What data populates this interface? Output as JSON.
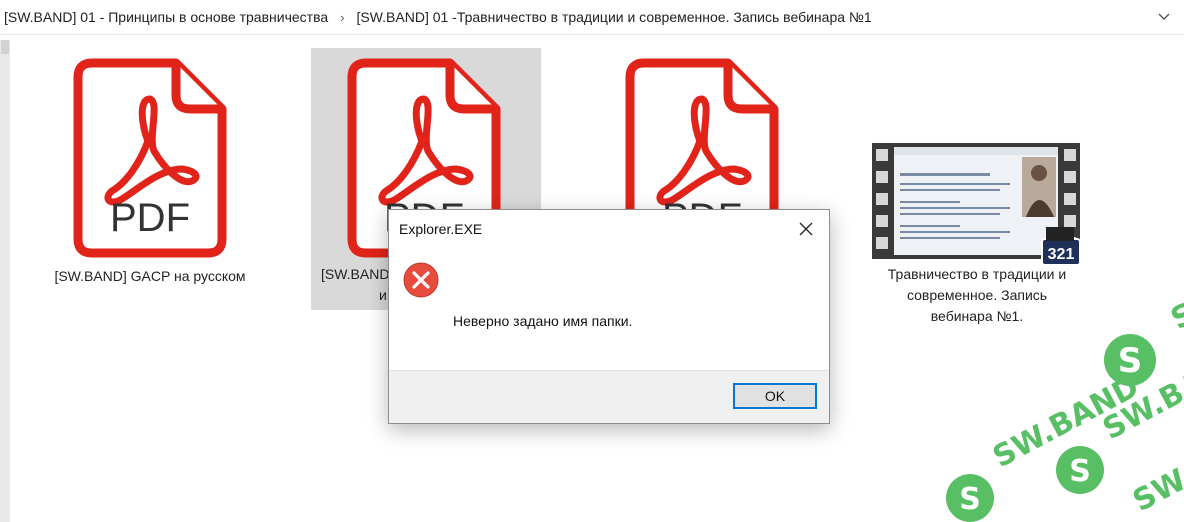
{
  "breadcrumb": {
    "items": [
      "[SW.BAND] 01 - Принципы в основе травничества",
      "[SW.BAND] 01 -Травничество в традиции и современное. Запись вебинара №1"
    ],
    "separator": "›"
  },
  "files": [
    {
      "label_lines": [
        "[SW.BAND] GACP на русском"
      ],
      "icon": "pdf-icon",
      "icon_text": "PDF"
    },
    {
      "label_lines": [
        "[SW.BAND",
        "и"
      ],
      "icon": "pdf-icon",
      "icon_text": "PDF",
      "selected": true
    },
    {
      "label_lines": [],
      "icon": "pdf-icon",
      "icon_text": "PDF"
    },
    {
      "label_lines": [
        "Травничество в традиции и",
        "современное. Запись",
        "вебинара №1."
      ],
      "icon": "video-thumbnail-icon",
      "badge_text": "321"
    }
  ],
  "dialog": {
    "title": "Explorer.EXE",
    "message": "Неверно задано имя папки.",
    "ok_label": "OK",
    "icon": "error-icon"
  },
  "watermark": {
    "text": "SW.BAND"
  },
  "colors": {
    "pdf_red": "#e2231a",
    "dialog_accent": "#0078d7",
    "error_red": "#e84c3d",
    "watermark_green": "#3cb44a"
  }
}
